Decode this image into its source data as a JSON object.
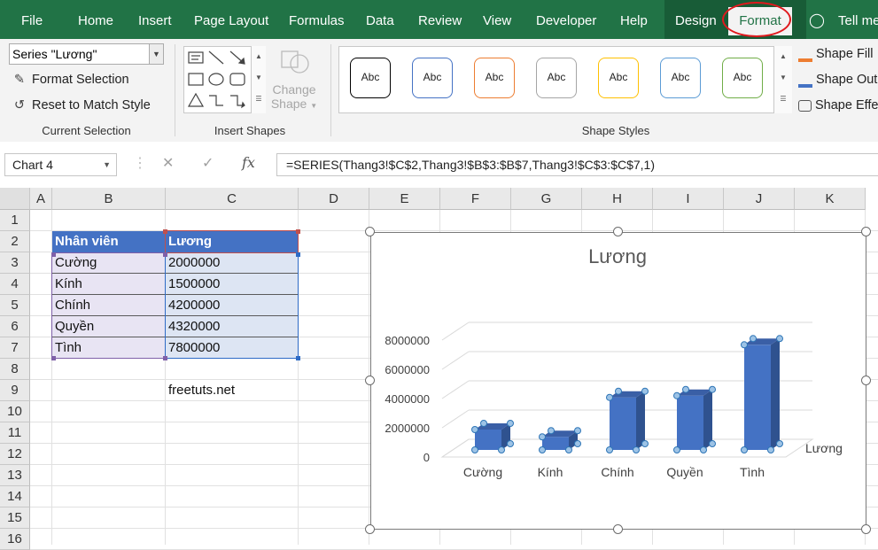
{
  "menu": {
    "items": [
      "File",
      "Home",
      "Insert",
      "Page Layout",
      "Formulas",
      "Data",
      "Review",
      "View",
      "Developer",
      "Help"
    ],
    "contextual": [
      "Design",
      "Format"
    ],
    "tell_me": "Tell me"
  },
  "ribbon": {
    "current_selection": {
      "selected_element": "Series \"Lương\"",
      "format_selection": "Format Selection",
      "reset_style": "Reset to Match Style",
      "label": "Current Selection"
    },
    "insert_shapes": {
      "change_shape_line1": "Change",
      "change_shape_line2": "Shape",
      "label": "Insert Shapes"
    },
    "shape_styles": {
      "swatches": [
        {
          "text": "Abc",
          "color": "#000000"
        },
        {
          "text": "Abc",
          "color": "#4472c4"
        },
        {
          "text": "Abc",
          "color": "#ed7d31"
        },
        {
          "text": "Abc",
          "color": "#a5a5a5"
        },
        {
          "text": "Abc",
          "color": "#ffc000"
        },
        {
          "text": "Abc",
          "color": "#5b9bd5"
        },
        {
          "text": "Abc",
          "color": "#70ad47"
        }
      ],
      "shape_fill": "Shape Fill",
      "shape_outline": "Shape Out",
      "shape_effects": "Shape Effe",
      "label": "Shape Styles"
    }
  },
  "formula_bar": {
    "name_box": "Chart 4",
    "formula": "=SERIES(Thang3!$C$2,Thang3!$B$3:$B$7,Thang3!$C$3:$C$7,1)"
  },
  "sheet": {
    "columns": [
      "A",
      "B",
      "C",
      "D",
      "E",
      "F",
      "G",
      "H",
      "I",
      "J",
      "K"
    ],
    "rows": [
      "1",
      "2",
      "3",
      "4",
      "5",
      "6",
      "7",
      "8",
      "9",
      "10",
      "11",
      "12",
      "13",
      "14",
      "15",
      "16"
    ],
    "table": {
      "headers": [
        "Nhân viên",
        "Lương"
      ],
      "rows": [
        [
          "Cường",
          "2000000"
        ],
        [
          "Kính",
          "1500000"
        ],
        [
          "Chính",
          "4200000"
        ],
        [
          "Quyền",
          "4320000"
        ],
        [
          "Tình",
          "7800000"
        ]
      ]
    },
    "note": "freetuts.net"
  },
  "chart_data": {
    "type": "bar",
    "title": "Lương",
    "categories": [
      "Cường",
      "Kính",
      "Chính",
      "Quyền",
      "Tình"
    ],
    "series": [
      {
        "name": "Lương",
        "values": [
          2000000,
          1500000,
          4200000,
          4320000,
          7800000
        ]
      }
    ],
    "y_ticks": [
      "0",
      "2000000",
      "4000000",
      "6000000",
      "8000000"
    ],
    "ylim": [
      0,
      8000000
    ],
    "legend_position": "right",
    "bar_color": "#4472c4",
    "selected_series": true
  }
}
